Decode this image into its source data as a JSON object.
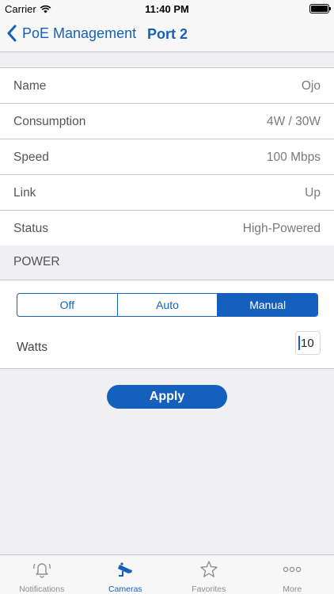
{
  "status_bar": {
    "carrier": "Carrier",
    "time": "11:40 PM"
  },
  "nav": {
    "back_label": "PoE Management",
    "title": "Port 2"
  },
  "info_rows": [
    {
      "key": "Name",
      "value": "Ojo"
    },
    {
      "key": "Consumption",
      "value": "4W / 30W"
    },
    {
      "key": "Speed",
      "value": "100 Mbps"
    },
    {
      "key": "Link",
      "value": "Up"
    },
    {
      "key": "Status",
      "value": "High-Powered"
    }
  ],
  "power": {
    "section_title": "POWER",
    "modes": [
      "Off",
      "Auto",
      "Manual"
    ],
    "selected_mode": "Manual",
    "watts_label": "Watts",
    "watts_value": "10"
  },
  "apply_label": "Apply",
  "tab_bar": {
    "items": [
      {
        "label": "Notifications",
        "icon": "bell-icon"
      },
      {
        "label": "Cameras",
        "icon": "camera-icon"
      },
      {
        "label": "Favorites",
        "icon": "star-icon"
      },
      {
        "label": "More",
        "icon": "more-icon"
      }
    ],
    "active": "Cameras"
  },
  "colors": {
    "accent": "#1560bd",
    "background": "#efeff4",
    "separator": "#c8c7cc"
  }
}
